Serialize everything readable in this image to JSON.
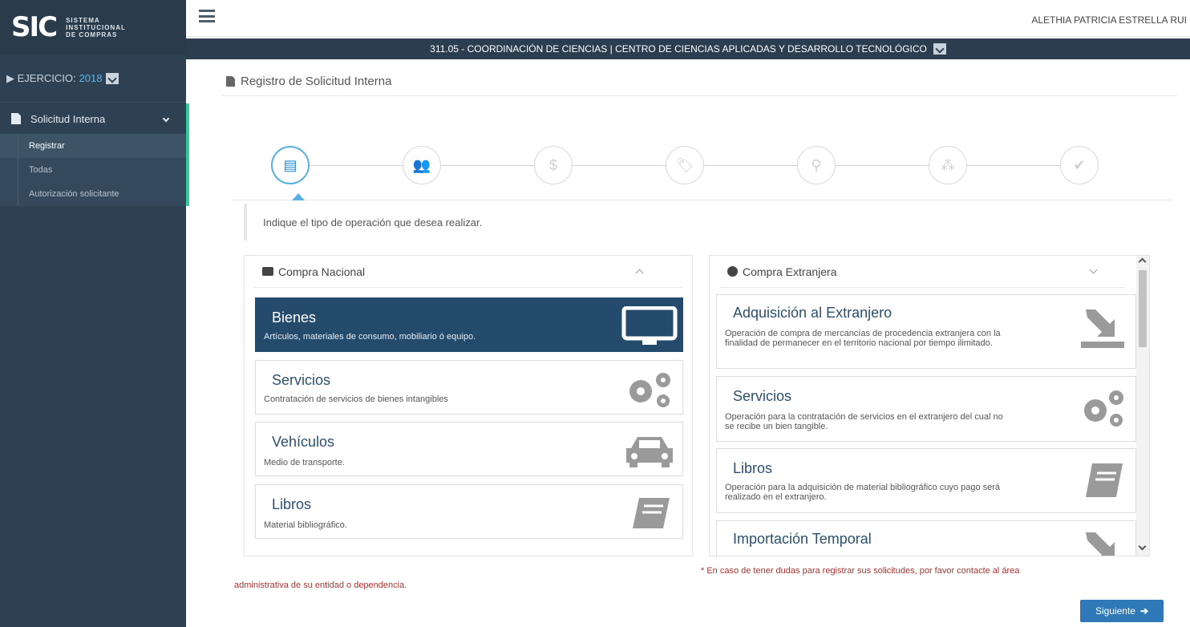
{
  "app": {
    "logo_mark": "SIC",
    "logo_line1": "SISTEMA",
    "logo_line2": "INSTITUCIONAL",
    "logo_line3": "DE COMPRAS"
  },
  "sidebar": {
    "ejercicio_label": "▶ EJERCICIO:",
    "ejercicio_year": "2018",
    "menu_title": "Solicitud Interna",
    "items": [
      {
        "label": "Registrar",
        "active": true
      },
      {
        "label": "Todas",
        "active": false
      },
      {
        "label": "Autorización solicitante",
        "active": false
      }
    ]
  },
  "header": {
    "user": "ALETHIA PATRICIA ESTRELLA RUI",
    "org": "311.05 - COORDINACIÓN DE CIENCIAS | CENTRO DE CIENCIAS APLICADAS Y DESARROLLO TECNOLÓGICO"
  },
  "page": {
    "title": "Registro de Solicitud Interna",
    "instruction": "Indique el tipo de operación que desea realizar."
  },
  "wizard": {
    "steps": [
      {
        "icon": "document-icon",
        "glyph": "▤",
        "active": true
      },
      {
        "icon": "users-icon",
        "glyph": "👥",
        "active": false
      },
      {
        "icon": "dollar-icon",
        "glyph": "$",
        "active": false
      },
      {
        "icon": "tag-icon",
        "glyph": "🏷",
        "active": false
      },
      {
        "icon": "map-marker-icon",
        "glyph": "⚲",
        "active": false
      },
      {
        "icon": "cubes-icon",
        "glyph": "⁂",
        "active": false
      },
      {
        "icon": "check-icon",
        "glyph": "✔",
        "active": false
      }
    ]
  },
  "nacional": {
    "title": "Compra Nacional",
    "cards": [
      {
        "title": "Bienes",
        "desc": "Artículos, materiales de consumo, mobiliario ó equipo.",
        "icon": "monitor-icon",
        "selected": true
      },
      {
        "title": "Servicios",
        "desc": "Contratación de servicios de bienes intangibles",
        "icon": "gears-icon",
        "selected": false
      },
      {
        "title": "Vehículos",
        "desc": "Medio de transporte.",
        "icon": "car-icon",
        "selected": false
      },
      {
        "title": "Libros",
        "desc": "Material bibliográfico.",
        "icon": "book-icon",
        "selected": false
      }
    ]
  },
  "extranjera": {
    "title": "Compra Extranjera",
    "cards": [
      {
        "title": "Adquisición al Extranjero",
        "desc": "Operación de compra de mercancías de procedencia extranjera con la finalidad de permanecer en el territorio nacional por tiempo ilimitado.",
        "icon": "import-icon"
      },
      {
        "title": "Servicios",
        "desc": "Operación para la contratación de servicios en el extranjero del cual no se recibe un bien tangible.",
        "icon": "gears-icon"
      },
      {
        "title": "Libros",
        "desc": "Operación para la adquisición de material bibliográfico cuyo pago será realizado en el extranjero.",
        "icon": "book-icon"
      },
      {
        "title": "Importación Temporal",
        "desc": "",
        "icon": "import-icon"
      }
    ]
  },
  "footer": {
    "note_line1": "* En caso de tener dudas para registrar sus solicitudes, por favor contacte al área",
    "note_line2": "administrativa de su entidad o dependencia.",
    "next_label": "Siguiente",
    "next_arrow": "➔"
  },
  "colors": {
    "sidebar_bg": "#2e4152",
    "accent": "#2ecc9a",
    "selected_card": "#244a6c",
    "primary_button": "#2f79b9",
    "note_text": "#aa3333"
  }
}
